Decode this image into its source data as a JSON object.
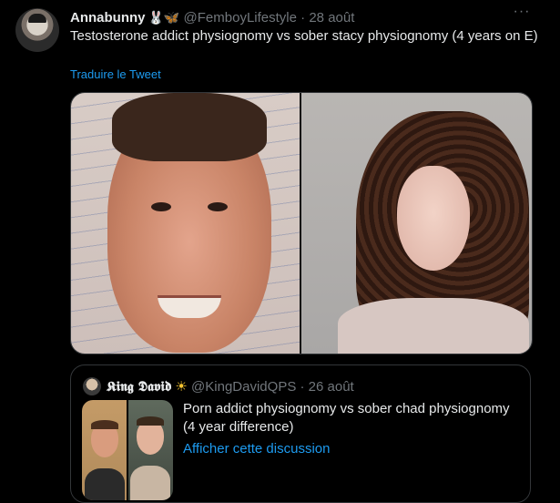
{
  "tweet": {
    "author_name": "Annabunny",
    "author_emojis": "🐰🦋",
    "handle": "@FemboyLifestyle",
    "separator": "·",
    "date": "28 août",
    "more_label": "···",
    "text": "Testosterone addict physiognomy vs sober stacy physiognomy (4 years on E)",
    "translate_label": "Traduire le Tweet"
  },
  "quoted": {
    "author_name": "𝕶𝖎𝖓𝖌 𝕯𝖆𝖛𝖎𝖉",
    "author_emoji": "☀",
    "handle": "@KingDavidQPS",
    "separator": "·",
    "date": "26 août",
    "text": "Porn addict physiognomy vs sober chad physiognomy (4 year difference)",
    "link_label": "Afficher cette discussion"
  },
  "colors": {
    "background": "#000000",
    "text": "#e7e9ea",
    "secondary": "#71767b",
    "link": "#1d9bf0",
    "border": "#333639"
  }
}
